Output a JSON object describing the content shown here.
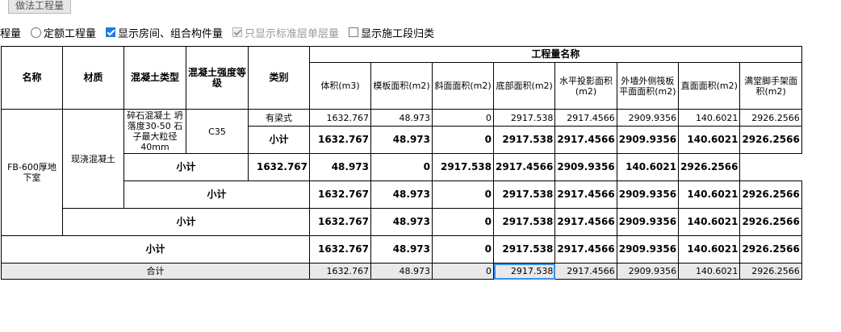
{
  "tab": {
    "label": "做法工程量"
  },
  "options": {
    "cut_label": "程量",
    "radio_quota": "定额工程量",
    "cb_show_room": "显示房间、组合构件量",
    "cb_only_std": "只显示标准层单层量",
    "cb_show_stage": "显示施工段归类"
  },
  "headers": {
    "name": "名称",
    "material": "材质",
    "concrete_type": "混凝土类型",
    "concrete_grade": "混凝土强度等级",
    "category": "类别",
    "qty_group": "工程量名称",
    "cols": [
      "体积(m3)",
      "模板面积(m2)",
      "斜面面积(m2)",
      "底部面积(m2)",
      "水平投影面积(m2)",
      "外墙外侧筏板平面面积(m2)",
      "直面面积(m2)",
      "满堂脚手架面积(m2)"
    ]
  },
  "body": {
    "name": "FB-600厚地下室",
    "material": "现浇混凝土",
    "concrete_type": "碎石混凝土 坍落度30-50 石子最大粒径40mm",
    "concrete_grade": "C35",
    "category_beam": "有梁式",
    "subtotal": "小计",
    "total": "合计",
    "row_normal": [
      "1632.767",
      "48.973",
      "0",
      "2917.538",
      "2917.4566",
      "2909.9356",
      "140.6021",
      "2926.2566"
    ],
    "row_bold": [
      "1632.767",
      "48.973",
      "0",
      "2917.538",
      "2917.4566",
      "2909.9356",
      "140.6021",
      "2926.2566"
    ],
    "row_total": [
      "1632.767",
      "48.973",
      "0",
      "2917.538",
      "2917.4566",
      "2909.9356",
      "140.6021",
      "2926.2566"
    ]
  }
}
